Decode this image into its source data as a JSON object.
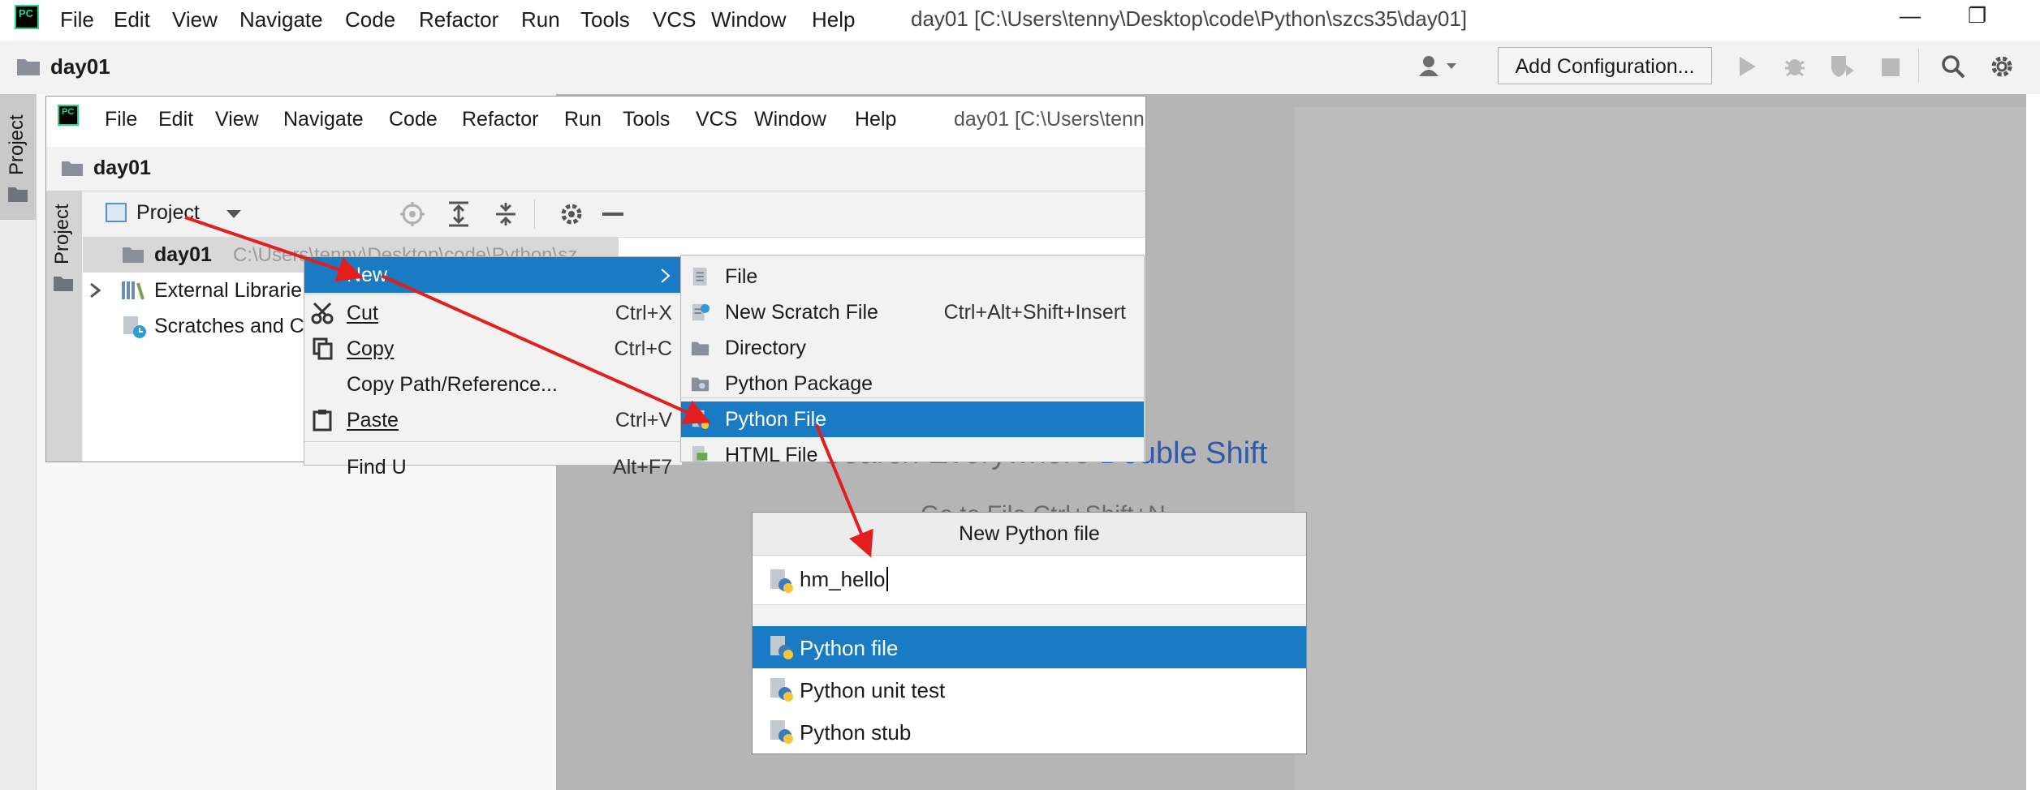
{
  "colors": {
    "accent_selection": "#1a7bc4",
    "arrow_red": "#e31e1e",
    "pycharm_green": "#21d789",
    "editor_bg": "#b5b5b5",
    "search_key_blue": "#2e5aa8"
  },
  "window": {
    "title": "day01 [C:\\Users\\tenny\\Desktop\\code\\Python\\szcs35\\day01]",
    "logo_text": "PC",
    "menu": [
      {
        "label": "File",
        "mnemonic": "F"
      },
      {
        "label": "Edit",
        "mnemonic": "E"
      },
      {
        "label": "View",
        "mnemonic": "V"
      },
      {
        "label": "Navigate",
        "mnemonic": "N"
      },
      {
        "label": "Code",
        "mnemonic": "C"
      },
      {
        "label": "Refactor",
        "mnemonic": "R"
      },
      {
        "label": "Run",
        "mnemonic": "u"
      },
      {
        "label": "Tools",
        "mnemonic": "T"
      },
      {
        "label": "VCS",
        "mnemonic": "S"
      },
      {
        "label": "Window",
        "mnemonic": "W"
      },
      {
        "label": "Help",
        "mnemonic": "H"
      }
    ],
    "controls": {
      "minimize": "—",
      "restore": "❐"
    }
  },
  "navbar": {
    "breadcrumb": "day01",
    "add_config_label": "Add Configuration...",
    "icons": [
      "user-icon",
      "run-icon",
      "debug-icon",
      "coverage-icon",
      "stop-icon",
      "search-icon",
      "settings-icon"
    ]
  },
  "left_strip": {
    "tab_label": "Project"
  },
  "inner": {
    "title": "day01 [C:\\Users\\tenn",
    "breadcrumb": "day01",
    "strip_tab_label": "Project",
    "project_dropdown": "Project",
    "tree": [
      {
        "label": "day01",
        "path": "C:\\Users\\tenny\\Desktop\\code\\Python\\sz",
        "selected": true
      },
      {
        "label": "External Librarie",
        "expandable": true
      },
      {
        "label": "Scratches and C"
      }
    ]
  },
  "context_menu": [
    {
      "label": "New",
      "shortcut": "",
      "submenu": true,
      "selected": true
    },
    {
      "label": "Cut",
      "shortcut": "Ctrl+X",
      "icon": "scissors-icon"
    },
    {
      "label": "Copy",
      "shortcut": "Ctrl+C",
      "icon": "copy-icon"
    },
    {
      "label": "Copy Path/Reference...",
      "shortcut": ""
    },
    {
      "label": "Paste",
      "shortcut": "Ctrl+V",
      "icon": "clipboard-icon"
    },
    {
      "label": "Find U",
      "shortcut": "Alt+F7"
    }
  ],
  "new_submenu": [
    {
      "label": "File",
      "shortcut": "",
      "icon": "file-icon"
    },
    {
      "label": "New Scratch File",
      "shortcut": "Ctrl+Alt+Shift+Insert",
      "icon": "scratch-file-icon"
    },
    {
      "label": "Directory",
      "shortcut": "",
      "icon": "folder-icon"
    },
    {
      "label": "Python Package",
      "shortcut": "",
      "icon": "package-icon"
    },
    {
      "label": "Python File",
      "shortcut": "",
      "icon": "python-file-icon",
      "selected": true
    },
    {
      "label": "HTML File",
      "shortcut": "",
      "icon": "html-file-icon"
    }
  ],
  "search_hint": {
    "text": "Search Everywhere",
    "key": "Double Shift",
    "second_line": "Go to File  Ctrl+Shift+N"
  },
  "dialog": {
    "title": "New Python file",
    "input_value": "hm_hello",
    "options": [
      {
        "label": "Python file",
        "selected": true
      },
      {
        "label": "Python unit test"
      },
      {
        "label": "Python stub"
      }
    ]
  }
}
